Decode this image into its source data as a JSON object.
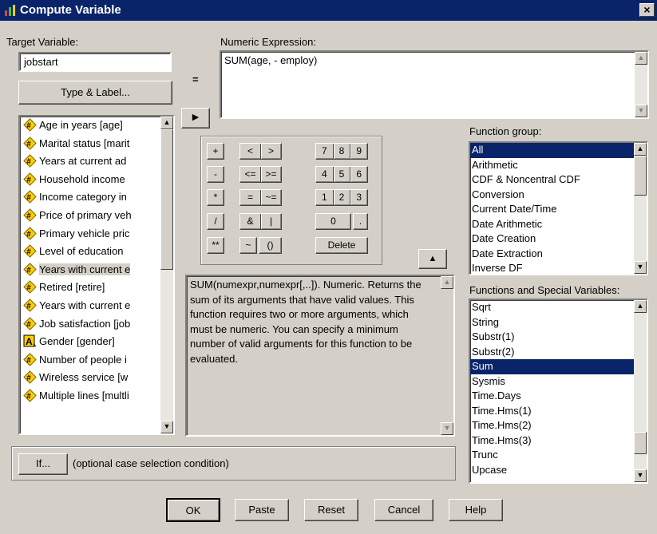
{
  "window": {
    "title": "Compute Variable",
    "close_glyph": "×"
  },
  "target": {
    "label": "Target Variable:",
    "value": "jobstart",
    "type_label_button": "Type & Label..."
  },
  "equals_sign": "=",
  "expression": {
    "label": "Numeric Expression:",
    "value": "SUM(age, - employ)"
  },
  "move_arrow": "▶",
  "variables": [
    {
      "label": "Age in years [age]",
      "type": "scale"
    },
    {
      "label": "Marital status [marit",
      "type": "scale"
    },
    {
      "label": "Years at current ad",
      "type": "scale"
    },
    {
      "label": "Household income",
      "type": "scale"
    },
    {
      "label": "Income category in",
      "type": "scale"
    },
    {
      "label": "Price of primary veh",
      "type": "scale"
    },
    {
      "label": "Primary vehicle pric",
      "type": "scale"
    },
    {
      "label": "Level of education",
      "type": "scale"
    },
    {
      "label": "Years with current e",
      "type": "scale",
      "highlighted": true
    },
    {
      "label": "Retired [retire]",
      "type": "scale"
    },
    {
      "label": "Years with current e",
      "type": "scale"
    },
    {
      "label": "Job satisfaction [job",
      "type": "scale"
    },
    {
      "label": "Gender [gender]",
      "type": "string"
    },
    {
      "label": "Number of people i",
      "type": "scale"
    },
    {
      "label": "Wireless service [w",
      "type": "scale"
    },
    {
      "label": "Multiple lines [multli",
      "type": "scale"
    }
  ],
  "keypad": {
    "row1": [
      "+",
      "<",
      ">",
      "7",
      "8",
      "9"
    ],
    "row2": [
      "-",
      "<=",
      ">=",
      "4",
      "5",
      "6"
    ],
    "row3": [
      "*",
      "=",
      "~=",
      "1",
      "2",
      "3"
    ],
    "row4": [
      "/",
      "&",
      "|",
      "0",
      "."
    ],
    "row5": [
      "**",
      "~",
      "()",
      "Delete"
    ],
    "up_arrow": "▲"
  },
  "description": "SUM(numexpr,numexpr[,..]). Numeric. Returns the sum of its arguments that have valid values. This function requires two or more arguments, which must be numeric. You can specify a minimum number of valid arguments for this function to be evaluated.",
  "function_group": {
    "label": "Function group:",
    "items": [
      "All",
      "Arithmetic",
      "CDF & Noncentral CDF",
      "Conversion",
      "Current Date/Time",
      "Date Arithmetic",
      "Date Creation",
      "Date Extraction",
      "Inverse DF"
    ],
    "selected": "All"
  },
  "functions": {
    "label": "Functions and Special Variables:",
    "items": [
      "Sqrt",
      "String",
      "Substr(1)",
      "Substr(2)",
      "Sum",
      "Sysmis",
      "Time.Days",
      "Time.Hms(1)",
      "Time.Hms(2)",
      "Time.Hms(3)",
      "Trunc",
      "Upcase"
    ],
    "selected": "Sum"
  },
  "if_section": {
    "button": "If...",
    "condition": "(optional case selection condition)"
  },
  "buttons": {
    "ok": "OK",
    "paste": "Paste",
    "reset": "Reset",
    "cancel": "Cancel",
    "help": "Help"
  },
  "colors": {
    "titlebar": "#0a246a",
    "selection": "#0a246a",
    "face": "#d4d0c8",
    "var_icon": "#ffd000"
  }
}
